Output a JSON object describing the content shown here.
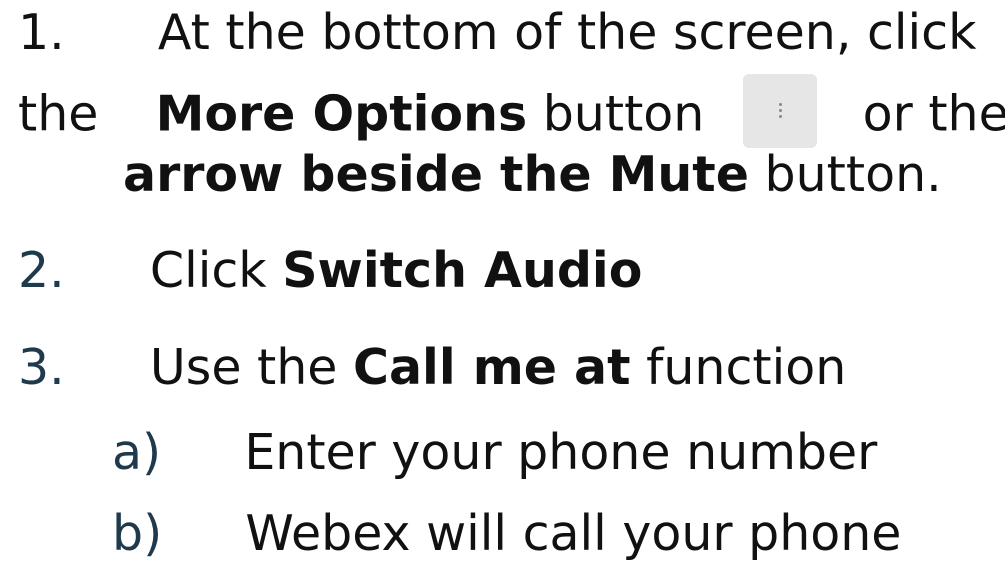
{
  "step1": {
    "number": "1.",
    "text_a": "At the bottom of the screen, click",
    "text_b_prefix": "the",
    "bold_more_options": "More Options",
    "text_button": "button",
    "text_or_the": "or the",
    "bold_arrow_mute": "arrow beside the Mute",
    "text_button_end": "button."
  },
  "step2": {
    "number": "2.",
    "text": "Click",
    "bold": "Switch Audio"
  },
  "step3": {
    "number": "3.",
    "text_pre": "Use the",
    "bold": "Call me at",
    "text_post": "function",
    "sub_items": [
      {
        "marker": "a)",
        "text": "Enter your phone number"
      },
      {
        "marker": "b)",
        "text": "Webex will call your phone"
      }
    ]
  },
  "icons": {
    "more_options": "more-options-vertical-dots-icon"
  },
  "colors": {
    "text": "#111111",
    "list_number": "#1f3a4d",
    "button_bg": "#e6e6e6"
  }
}
